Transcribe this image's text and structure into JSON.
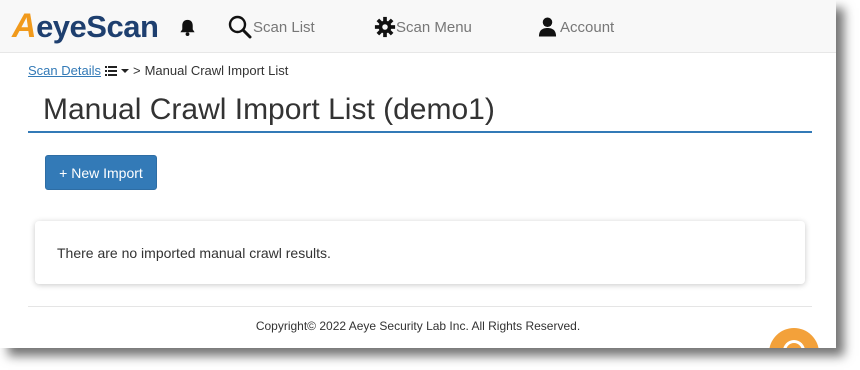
{
  "navbar": {
    "logo_first_letter": "A",
    "logo_rest": "eyeScan",
    "scan_list_label": "Scan List",
    "scan_menu_label": "Scan Menu",
    "account_label": "Account"
  },
  "breadcrumb": {
    "link_label": "Scan Details",
    "separator": ">",
    "current": "Manual Crawl Import List"
  },
  "page": {
    "title": "Manual Crawl Import List (demo1)",
    "new_import_label": "+ New Import",
    "empty_message": "There are no imported manual crawl results."
  },
  "footer": {
    "copyright": "Copyright© 2022 Aeye Security Lab Inc. All Rights Reserved."
  },
  "colors": {
    "primary": "#337ab7",
    "logo_orange": "#f19a1c",
    "logo_navy": "#1e3f6f",
    "fab_orange": "#f3a13a"
  },
  "icons": {
    "notifications": "bell-icon",
    "scan_list": "search-icon",
    "scan_menu": "gear-icon",
    "account": "user-icon",
    "breadcrumb_menu": "list-icon",
    "breadcrumb_dropdown": "caret-down-icon"
  }
}
